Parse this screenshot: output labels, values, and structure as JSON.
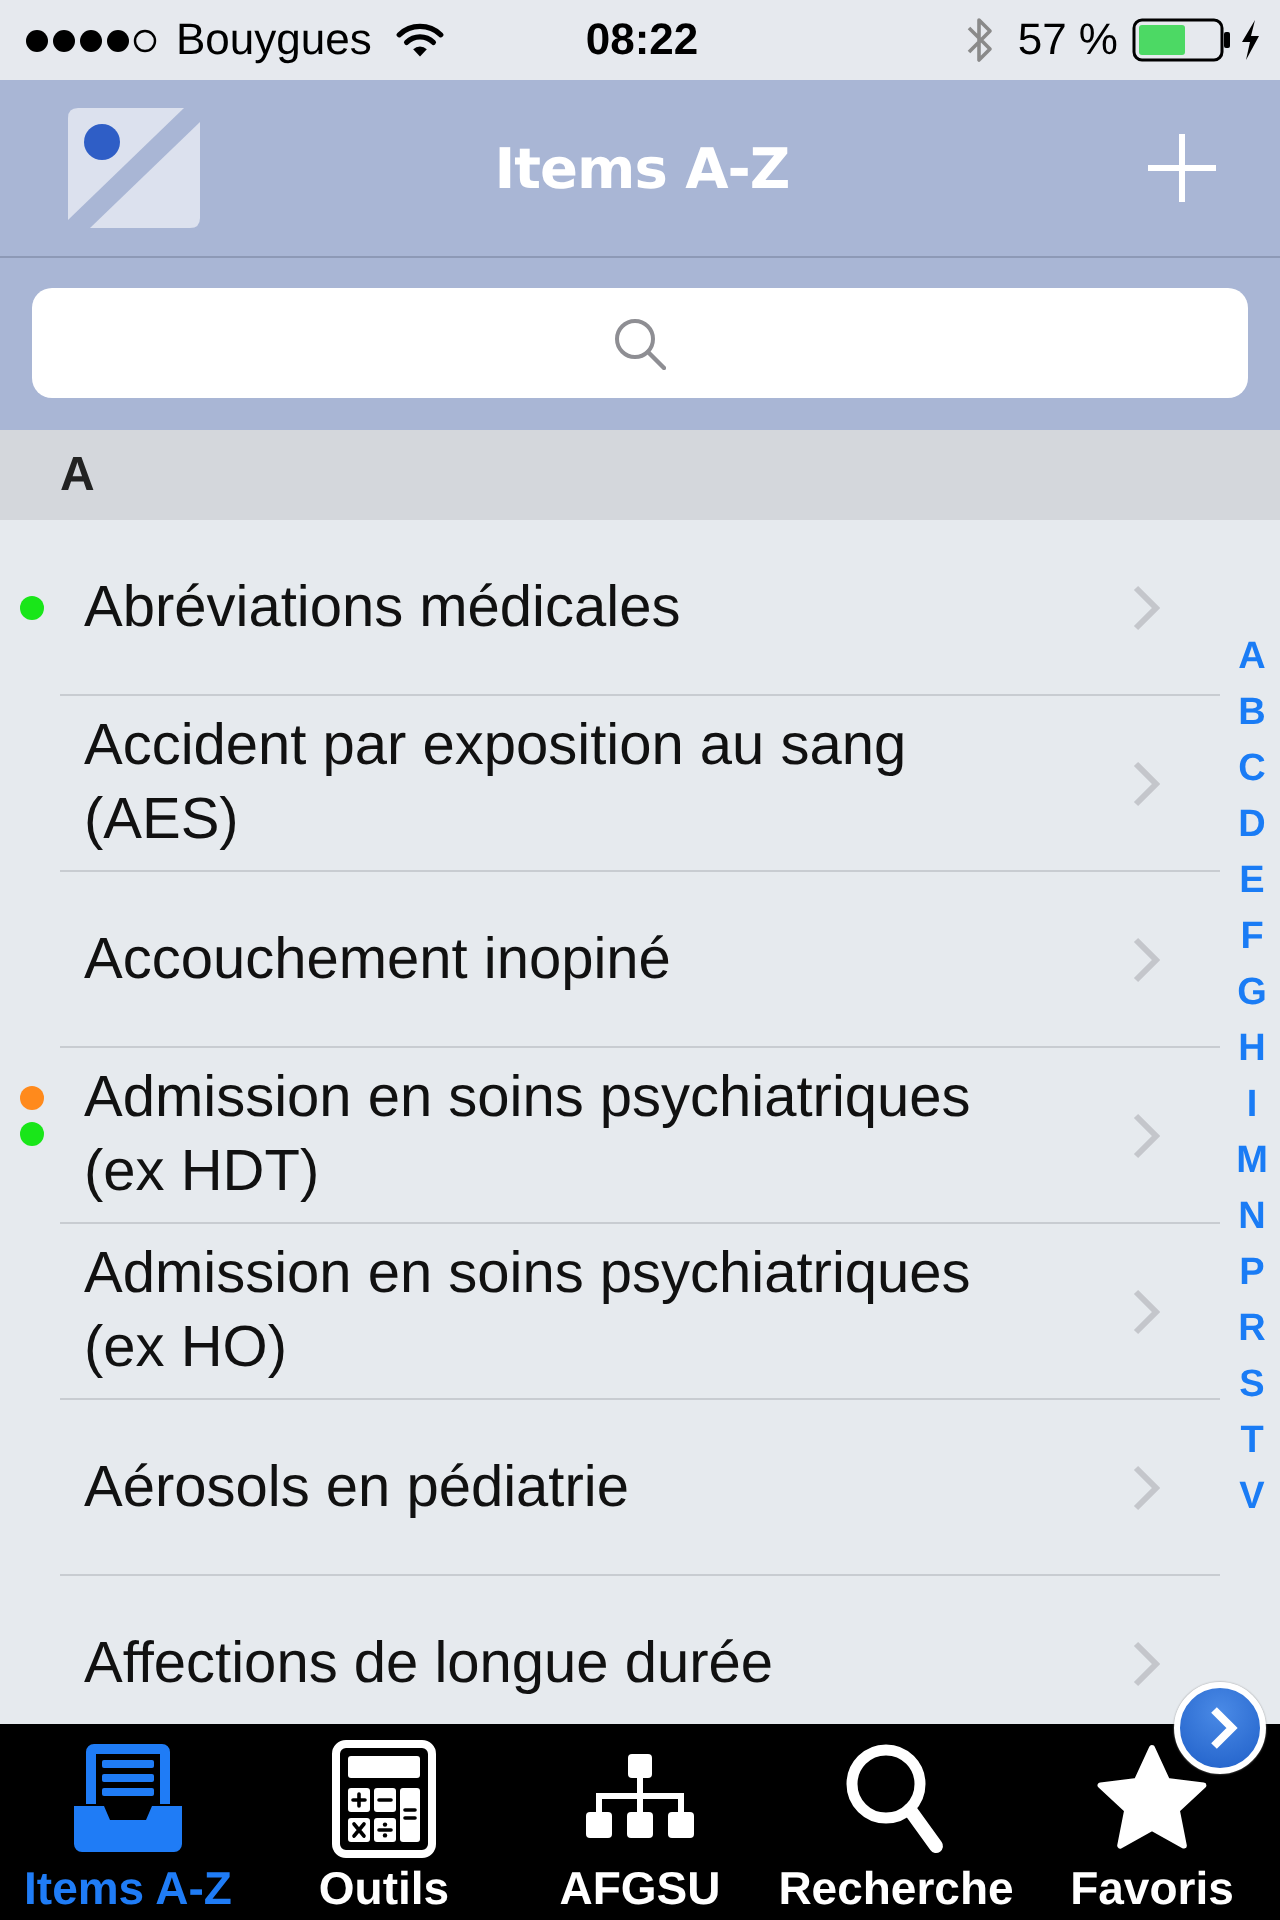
{
  "status_bar": {
    "carrier": "Bouygues",
    "time": "08:22",
    "battery": "57 %"
  },
  "nav_bar": {
    "title": "Items A-Z"
  },
  "section": {
    "title": "A",
    "items": [
      {
        "label": "Abréviations médicales",
        "markers": [
          {
            "color": "#19e619"
          }
        ]
      },
      {
        "label": "Accident par exposition au sang (AES)"
      },
      {
        "label": "Accouchement inopiné"
      },
      {
        "label": "Admission en soins psychiatriques (ex HDT)",
        "markers": [
          {
            "color": "#ff8a1c"
          },
          {
            "color": "#19e619"
          }
        ]
      },
      {
        "label": "Admission en soins psychiatriques (ex HO)"
      },
      {
        "label": "Aérosols en pédiatrie"
      },
      {
        "label": "Affections de longue durée"
      }
    ]
  },
  "index_letters": [
    "A",
    "B",
    "C",
    "D",
    "E",
    "F",
    "G",
    "H",
    "I",
    "M",
    "N",
    "P",
    "R",
    "S",
    "T",
    "V"
  ],
  "tabs": [
    {
      "label": "Items A-Z",
      "selected": true
    },
    {
      "label": "Outils",
      "selected": false
    },
    {
      "label": "AFGSU",
      "selected": false
    },
    {
      "label": "Recherche",
      "selected": false
    },
    {
      "label": "Favoris",
      "selected": false
    }
  ]
}
